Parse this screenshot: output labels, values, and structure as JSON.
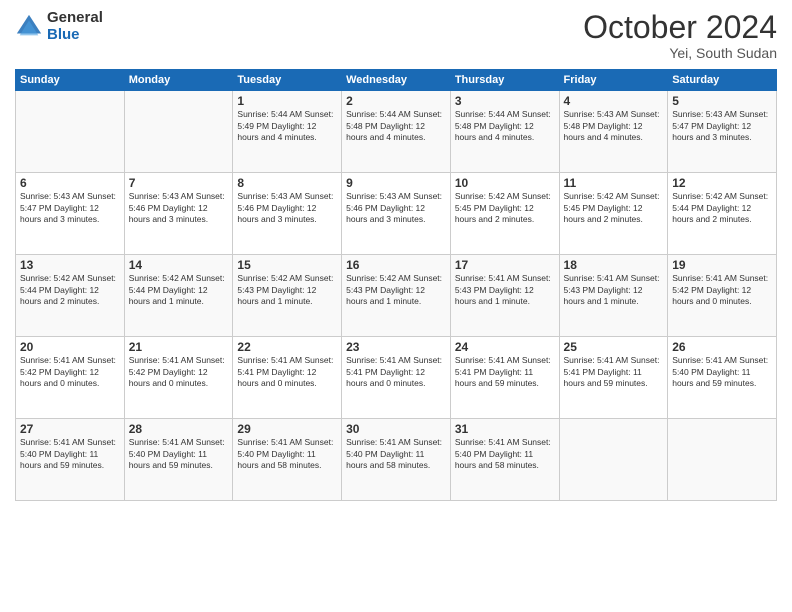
{
  "header": {
    "logo_general": "General",
    "logo_blue": "Blue",
    "month_title": "October 2024",
    "location": "Yei, South Sudan"
  },
  "days_of_week": [
    "Sunday",
    "Monday",
    "Tuesday",
    "Wednesday",
    "Thursday",
    "Friday",
    "Saturday"
  ],
  "weeks": [
    [
      {
        "num": "",
        "info": ""
      },
      {
        "num": "",
        "info": ""
      },
      {
        "num": "1",
        "info": "Sunrise: 5:44 AM\nSunset: 5:49 PM\nDaylight: 12 hours\nand 4 minutes."
      },
      {
        "num": "2",
        "info": "Sunrise: 5:44 AM\nSunset: 5:48 PM\nDaylight: 12 hours\nand 4 minutes."
      },
      {
        "num": "3",
        "info": "Sunrise: 5:44 AM\nSunset: 5:48 PM\nDaylight: 12 hours\nand 4 minutes."
      },
      {
        "num": "4",
        "info": "Sunrise: 5:43 AM\nSunset: 5:48 PM\nDaylight: 12 hours\nand 4 minutes."
      },
      {
        "num": "5",
        "info": "Sunrise: 5:43 AM\nSunset: 5:47 PM\nDaylight: 12 hours\nand 3 minutes."
      }
    ],
    [
      {
        "num": "6",
        "info": "Sunrise: 5:43 AM\nSunset: 5:47 PM\nDaylight: 12 hours\nand 3 minutes."
      },
      {
        "num": "7",
        "info": "Sunrise: 5:43 AM\nSunset: 5:46 PM\nDaylight: 12 hours\nand 3 minutes."
      },
      {
        "num": "8",
        "info": "Sunrise: 5:43 AM\nSunset: 5:46 PM\nDaylight: 12 hours\nand 3 minutes."
      },
      {
        "num": "9",
        "info": "Sunrise: 5:43 AM\nSunset: 5:46 PM\nDaylight: 12 hours\nand 3 minutes."
      },
      {
        "num": "10",
        "info": "Sunrise: 5:42 AM\nSunset: 5:45 PM\nDaylight: 12 hours\nand 2 minutes."
      },
      {
        "num": "11",
        "info": "Sunrise: 5:42 AM\nSunset: 5:45 PM\nDaylight: 12 hours\nand 2 minutes."
      },
      {
        "num": "12",
        "info": "Sunrise: 5:42 AM\nSunset: 5:44 PM\nDaylight: 12 hours\nand 2 minutes."
      }
    ],
    [
      {
        "num": "13",
        "info": "Sunrise: 5:42 AM\nSunset: 5:44 PM\nDaylight: 12 hours\nand 2 minutes."
      },
      {
        "num": "14",
        "info": "Sunrise: 5:42 AM\nSunset: 5:44 PM\nDaylight: 12 hours\nand 1 minute."
      },
      {
        "num": "15",
        "info": "Sunrise: 5:42 AM\nSunset: 5:43 PM\nDaylight: 12 hours\nand 1 minute."
      },
      {
        "num": "16",
        "info": "Sunrise: 5:42 AM\nSunset: 5:43 PM\nDaylight: 12 hours\nand 1 minute."
      },
      {
        "num": "17",
        "info": "Sunrise: 5:41 AM\nSunset: 5:43 PM\nDaylight: 12 hours\nand 1 minute."
      },
      {
        "num": "18",
        "info": "Sunrise: 5:41 AM\nSunset: 5:43 PM\nDaylight: 12 hours\nand 1 minute."
      },
      {
        "num": "19",
        "info": "Sunrise: 5:41 AM\nSunset: 5:42 PM\nDaylight: 12 hours\nand 0 minutes."
      }
    ],
    [
      {
        "num": "20",
        "info": "Sunrise: 5:41 AM\nSunset: 5:42 PM\nDaylight: 12 hours\nand 0 minutes."
      },
      {
        "num": "21",
        "info": "Sunrise: 5:41 AM\nSunset: 5:42 PM\nDaylight: 12 hours\nand 0 minutes."
      },
      {
        "num": "22",
        "info": "Sunrise: 5:41 AM\nSunset: 5:41 PM\nDaylight: 12 hours\nand 0 minutes."
      },
      {
        "num": "23",
        "info": "Sunrise: 5:41 AM\nSunset: 5:41 PM\nDaylight: 12 hours\nand 0 minutes."
      },
      {
        "num": "24",
        "info": "Sunrise: 5:41 AM\nSunset: 5:41 PM\nDaylight: 11 hours\nand 59 minutes."
      },
      {
        "num": "25",
        "info": "Sunrise: 5:41 AM\nSunset: 5:41 PM\nDaylight: 11 hours\nand 59 minutes."
      },
      {
        "num": "26",
        "info": "Sunrise: 5:41 AM\nSunset: 5:40 PM\nDaylight: 11 hours\nand 59 minutes."
      }
    ],
    [
      {
        "num": "27",
        "info": "Sunrise: 5:41 AM\nSunset: 5:40 PM\nDaylight: 11 hours\nand 59 minutes."
      },
      {
        "num": "28",
        "info": "Sunrise: 5:41 AM\nSunset: 5:40 PM\nDaylight: 11 hours\nand 59 minutes."
      },
      {
        "num": "29",
        "info": "Sunrise: 5:41 AM\nSunset: 5:40 PM\nDaylight: 11 hours\nand 58 minutes."
      },
      {
        "num": "30",
        "info": "Sunrise: 5:41 AM\nSunset: 5:40 PM\nDaylight: 11 hours\nand 58 minutes."
      },
      {
        "num": "31",
        "info": "Sunrise: 5:41 AM\nSunset: 5:40 PM\nDaylight: 11 hours\nand 58 minutes."
      },
      {
        "num": "",
        "info": ""
      },
      {
        "num": "",
        "info": ""
      }
    ]
  ]
}
